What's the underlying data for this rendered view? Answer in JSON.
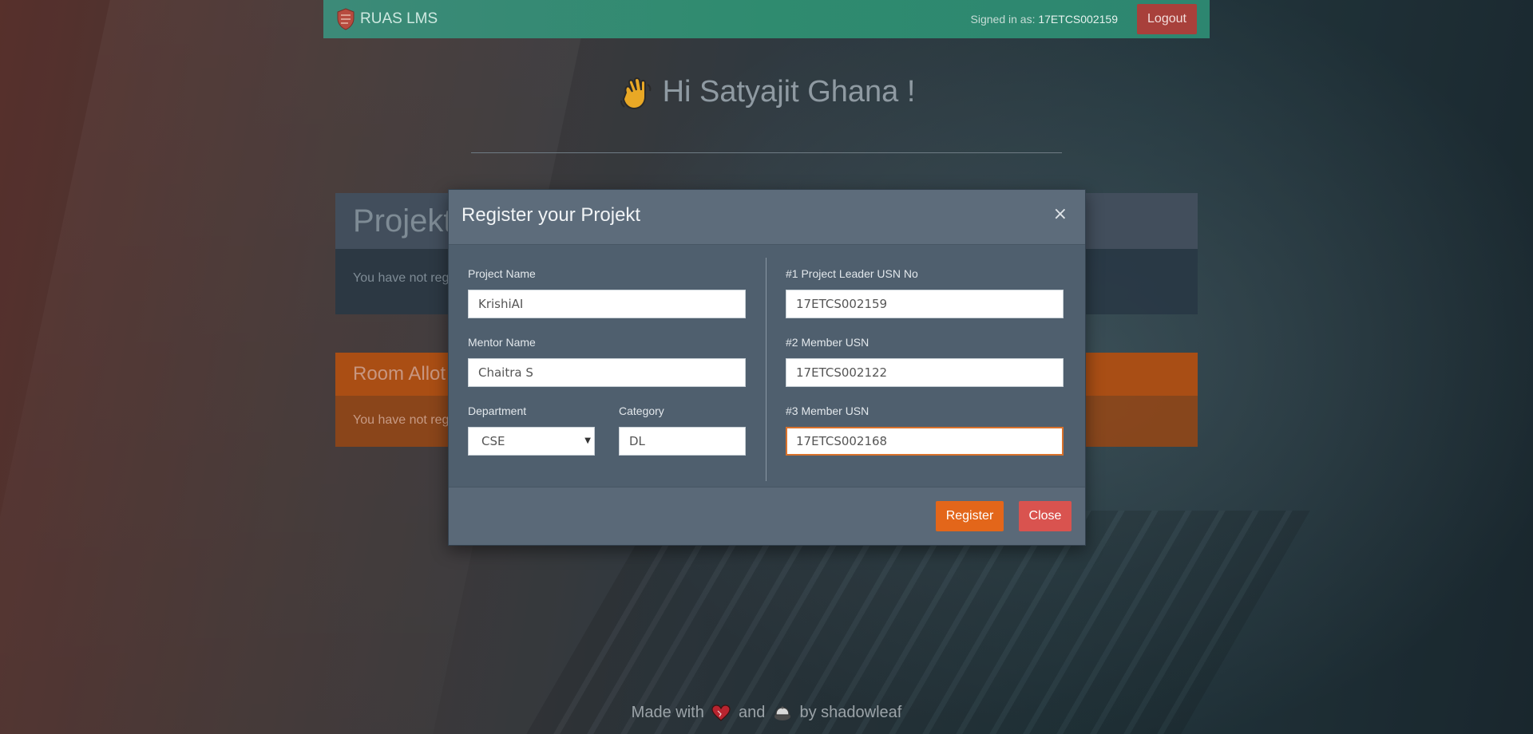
{
  "navbar": {
    "brand": "RUAS LMS",
    "signed_in_prefix": "Signed in as: ",
    "signed_in_user": "17ETCS002159",
    "logout_label": "Logout"
  },
  "greeting": {
    "icon": "waving-hand-icon",
    "text": "Hi Satyajit Ghana !"
  },
  "cards": {
    "projekt_title": "Projekt",
    "projekt_body": "You have not reg",
    "room_title": "Room Allot",
    "room_body": "You have not reg"
  },
  "modal": {
    "title": "Register your Projekt",
    "close_icon": "×",
    "fields": {
      "project_name_label": "Project Name",
      "project_name_value": "KrishiAI",
      "mentor_name_label": "Mentor Name",
      "mentor_name_value": "Chaitra S",
      "department_label": "Department",
      "department_value": "CSE",
      "category_label": "Category",
      "category_value": "DL",
      "leader_label": "#1 Project Leader USN No",
      "leader_value": "17ETCS002159",
      "member2_label": "#2 Member USN",
      "member2_value": "17ETCS002122",
      "member3_label": "#3 Member USN",
      "member3_value": "17ETCS002168"
    },
    "register_label": "Register",
    "close_label": "Close"
  },
  "footer": {
    "made_with": "Made with",
    "and": "and",
    "by": "by shadowleaf",
    "icons": [
      "heart-icon",
      "coffee-icon"
    ]
  },
  "colors": {
    "navbar": "#2f8b6f",
    "logout": "#a8403b",
    "modal_bg": "#4f5f6e",
    "register": "#e3661a",
    "close": "#d9534f",
    "focus_border": "#d9722c"
  }
}
